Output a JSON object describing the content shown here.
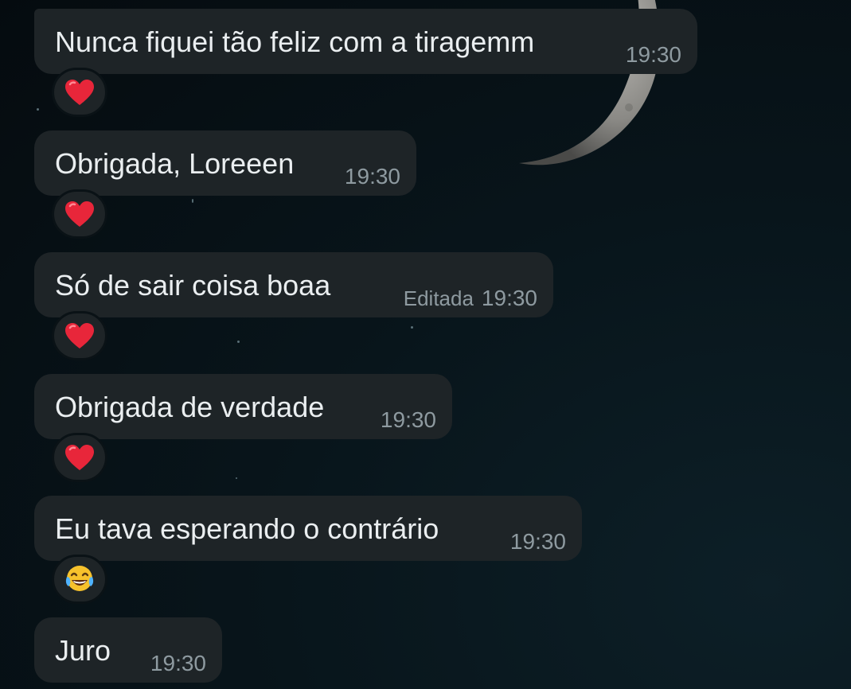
{
  "messages": [
    {
      "text": "Nunca fiquei tão feliz com a tiragemm",
      "edited": "",
      "time": "19:30",
      "reaction": "red-heart"
    },
    {
      "text": "Obrigada, Loreeen",
      "edited": "",
      "time": "19:30",
      "reaction": "red-heart"
    },
    {
      "text": "Só de sair coisa boaa",
      "edited": "Editada",
      "time": "19:30",
      "reaction": "red-heart"
    },
    {
      "text": "Obrigada de verdade",
      "edited": "",
      "time": "19:30",
      "reaction": "red-heart"
    },
    {
      "text": "Eu tava esperando o contrário",
      "edited": "",
      "time": "19:30",
      "reaction": "face-with-tears-of-joy"
    },
    {
      "text": "Juro",
      "edited": "",
      "time": "19:30",
      "reaction": ""
    }
  ],
  "colors": {
    "bubble": "#1e2427",
    "text": "#eaeef0",
    "meta": "#8e9aa0",
    "background": "#08151b",
    "heart": "#e8263a",
    "laugh_face": "#f7c22c"
  }
}
